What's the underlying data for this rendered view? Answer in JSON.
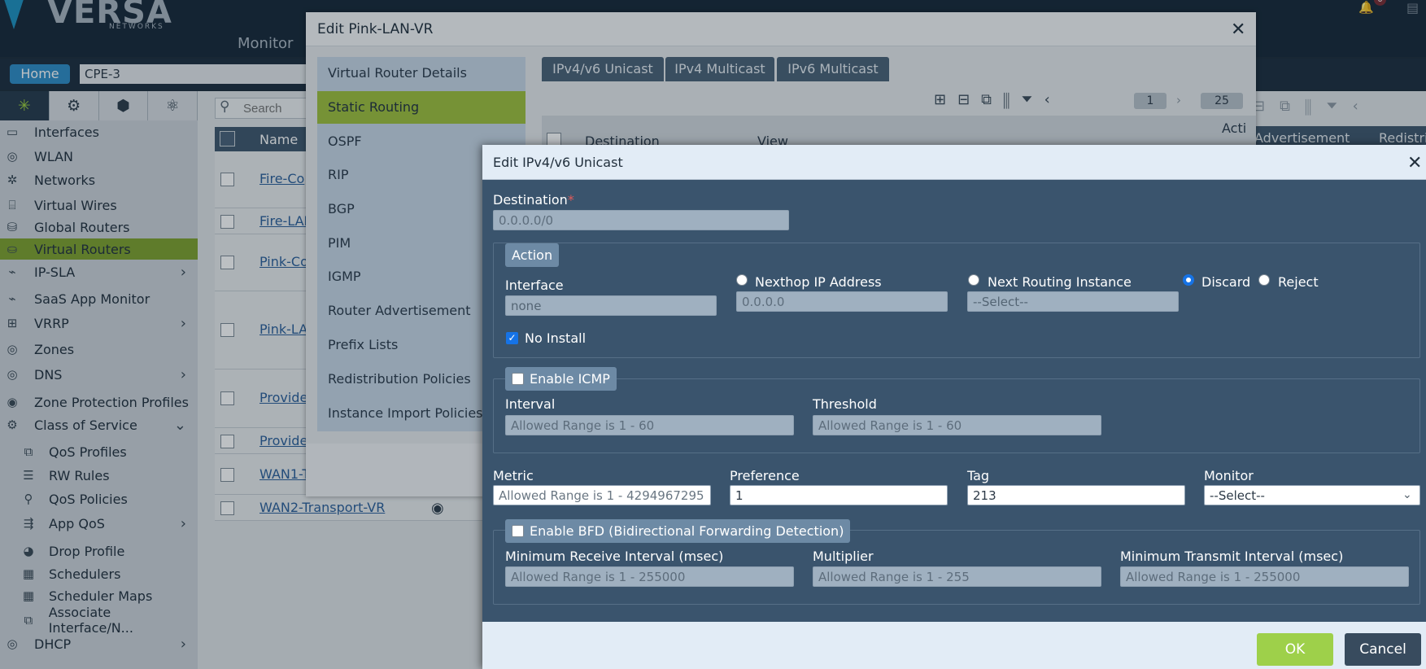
{
  "app": {
    "logo_text": "VERSA",
    "logo_sub": "NETWORKS",
    "top_menu": "Monitor",
    "notification_count": "0",
    "home_label": "Home",
    "device": "CPE-3"
  },
  "sidebar": {
    "items": [
      {
        "label": "Interfaces",
        "icon": "interfaces-icon"
      },
      {
        "label": "WLAN",
        "icon": "wlan-icon"
      },
      {
        "label": "Networks",
        "icon": "networks-icon"
      },
      {
        "label": "Virtual Wires",
        "icon": "virtual-wires-icon"
      },
      {
        "label": "Global Routers",
        "icon": "global-routers-icon"
      },
      {
        "label": "Virtual Routers",
        "icon": "virtual-routers-icon"
      },
      {
        "label": "IP-SLA",
        "icon": "ip-sla-icon"
      },
      {
        "label": "SaaS App Monitor",
        "icon": "saas-monitor-icon"
      },
      {
        "label": "VRRP",
        "icon": "vrrp-icon"
      },
      {
        "label": "Zones",
        "icon": "zones-icon"
      },
      {
        "label": "DNS",
        "icon": "dns-icon"
      },
      {
        "label": "Zone Protection Profiles",
        "icon": "zone-protection-icon"
      },
      {
        "label": "Class of Service",
        "icon": "class-of-service-icon"
      },
      {
        "label": "QoS Profiles",
        "icon": "qos-profiles-icon"
      },
      {
        "label": "RW Rules",
        "icon": "rw-rules-icon"
      },
      {
        "label": "QoS Policies",
        "icon": "qos-policies-icon"
      },
      {
        "label": "App QoS",
        "icon": "app-qos-icon"
      },
      {
        "label": "Drop Profile",
        "icon": "drop-profile-icon"
      },
      {
        "label": "Schedulers",
        "icon": "schedulers-icon"
      },
      {
        "label": "Scheduler Maps",
        "icon": "scheduler-maps-icon"
      },
      {
        "label": "Associate Interface/N...",
        "icon": "associate-interface-icon"
      },
      {
        "label": "DHCP",
        "icon": "dhcp-icon"
      }
    ]
  },
  "list": {
    "search_placeholder": "Search",
    "name_header": "Name",
    "rows": [
      "Fire-Co",
      "Fire-LAN",
      "Pink-Co",
      "Pink-LA",
      "Provide",
      "Provide",
      "WAN1-T",
      "WAN2-Transport-VR"
    ],
    "right_headers": [
      "Advertisement",
      "Redistri"
    ]
  },
  "modal1": {
    "title": "Edit Pink-LAN-VR",
    "nav": [
      "Virtual Router Details",
      "Static Routing",
      "OSPF",
      "RIP",
      "BGP",
      "PIM",
      "IGMP",
      "Router Advertisement",
      "Prefix Lists",
      "Redistribution Policies",
      "Instance Import Policies"
    ],
    "tabs": [
      "IPv4/v6 Unicast",
      "IPv4 Multicast",
      "IPv6 Multicast"
    ],
    "page": "1",
    "page_size": "25",
    "grid_headers": {
      "destination": "Destination",
      "view": "View",
      "action": "Acti"
    }
  },
  "modal2": {
    "title": "Edit IPv4/v6 Unicast",
    "destination_label": "Destination",
    "destination_required": "*",
    "destination_placeholder": "0.0.0.0/0",
    "action_legend": "Action",
    "interface_label": "Interface",
    "interface_value": "none",
    "nexthop_label": "Nexthop IP Address",
    "nexthop_placeholder": "0.0.0.0",
    "next_instance_label": "Next Routing Instance",
    "next_instance_value": "--Select--",
    "discard_label": "Discard",
    "reject_label": "Reject",
    "selected_action": "Discard",
    "no_install_label": "No Install",
    "no_install_checked": true,
    "icmp_legend": "Enable ICMP",
    "icmp_checked": false,
    "interval_label": "Interval",
    "interval_placeholder": "Allowed Range is 1 - 60",
    "threshold_label": "Threshold",
    "threshold_placeholder": "Allowed Range is 1 - 60",
    "metric_label": "Metric",
    "metric_placeholder": "Allowed Range is 1 - 4294967295",
    "preference_label": "Preference",
    "preference_value": "1",
    "tag_label": "Tag",
    "tag_value": "213",
    "monitor_label": "Monitor",
    "monitor_value": "--Select--",
    "bfd_legend": "Enable BFD (Bidirectional Forwarding Detection)",
    "bfd_checked": false,
    "min_rx_label": "Minimum Receive Interval (msec)",
    "min_rx_placeholder": "Allowed Range is 1 - 255000",
    "multiplier_label": "Multiplier",
    "multiplier_placeholder": "Allowed Range is 1 - 255",
    "min_tx_label": "Minimum Transmit Interval (msec)",
    "min_tx_placeholder": "Allowed Range is 1 - 255000",
    "ok_label": "OK",
    "cancel_label": "Cancel"
  },
  "colors": {
    "accent_green": "#9ed04a",
    "active_nav": "#9ec03c",
    "form_bg": "#3a546d",
    "radio_blue": "#1673e6"
  }
}
